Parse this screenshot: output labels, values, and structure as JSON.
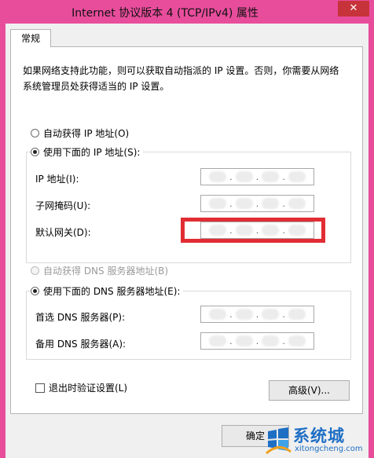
{
  "window": {
    "title": "Internet 协议版本 4 (TCP/IPv4) 属性",
    "close_glyph": "✕"
  },
  "tabs": [
    {
      "label": "常规",
      "selected": true
    }
  ],
  "intro": "如果网络支持此功能，则可以获取自动指派的 IP 设置。否则，你需要从网络系统管理员处获得适当的 IP 设置。",
  "ip": {
    "auto_label": "自动获得 IP 地址(O)",
    "manual_label": "使用下面的 IP 地址(S):",
    "selected": "manual",
    "fields": [
      {
        "label": "IP 地址(I):",
        "value_blurred": true
      },
      {
        "label": "子网掩码(U):",
        "value_blurred": true
      },
      {
        "label": "默认网关(D):",
        "value_blurred": true,
        "highlighted": true
      }
    ]
  },
  "dns": {
    "auto_label": "自动获得 DNS 服务器地址(B)",
    "auto_disabled": true,
    "manual_label": "使用下面的 DNS 服务器地址(E):",
    "selected": "manual",
    "fields": [
      {
        "label": "首选 DNS 服务器(P):",
        "value_blurred": true
      },
      {
        "label": "备用 DNS 服务器(A):",
        "value_blurred": true
      }
    ]
  },
  "validate_checkbox": {
    "label": "退出时验证设置(L)",
    "checked": false
  },
  "advanced_button": "高级(V)...",
  "ok_button": "确定",
  "colors": {
    "title_bar": "#e84d9c",
    "highlight_box": "#e12d33",
    "watermark": "#1e6fc4"
  },
  "watermark": {
    "brand": "系统城",
    "site": "xitongcheng.com"
  }
}
